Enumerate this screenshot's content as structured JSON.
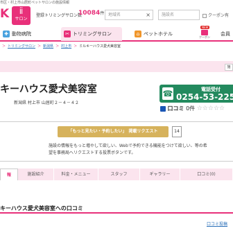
{
  "tagline": "市区・村上市山居町ペットサロンの施設情報",
  "header": {
    "logo_text": "K",
    "salon_badge_glyph": "ⅱ",
    "salon_badge_label": "サロン",
    "count_label": "登録トリミングサロン数",
    "count_value": "10084",
    "count_unit": "件",
    "area_placeholder": "地域名",
    "name_placeholder": "施設名",
    "clear_glyph": "×",
    "coupon_label": "クーポン有"
  },
  "nav": {
    "hospital": "動物病院",
    "trimming": "トリミングサロン",
    "hotel": "ペットホテル",
    "coupon_new": "NEW",
    "coupon": "クーポン",
    "member": "会員"
  },
  "breadcrumb": {
    "items": [
      "トリミングサロン",
      "新潟県",
      "村上市"
    ],
    "current": "ミルキーハウス愛犬美容室",
    "sep": "＞"
  },
  "band_button": "施",
  "salon": {
    "title": "キーハウス愛犬美容室",
    "address": "新潟県 村上市 山居町２－４－４２"
  },
  "tel": {
    "label": "電話受付",
    "number": "0254-53-225"
  },
  "reviews": {
    "label": "口コミ",
    "count": "0件",
    "stars": "☆☆☆☆☆"
  },
  "request": {
    "button_label": "「もっと見たい・予約したい」　掲載リクエスト",
    "count": "14",
    "description": "施設の情報をもっと増やして欲しい、Webで予約できる機能をつけて欲しい、等の希望を事務局へリクエストする投票ボタンです。"
  },
  "tabs": [
    {
      "label": "報"
    },
    {
      "label": "施設紹介"
    },
    {
      "label": "料金・メニュー"
    },
    {
      "label": "スタッフ"
    },
    {
      "label": "ギャラリー"
    },
    {
      "label": "口コミ(0)"
    }
  ],
  "lower": {
    "section_title": "キーハウス愛犬美容室への口コミ",
    "review_link": "口コミ投稿"
  },
  "colors": {
    "accent": "#e8307a",
    "tel_green": "#238a5e",
    "request_gold": "#d6b25c"
  }
}
